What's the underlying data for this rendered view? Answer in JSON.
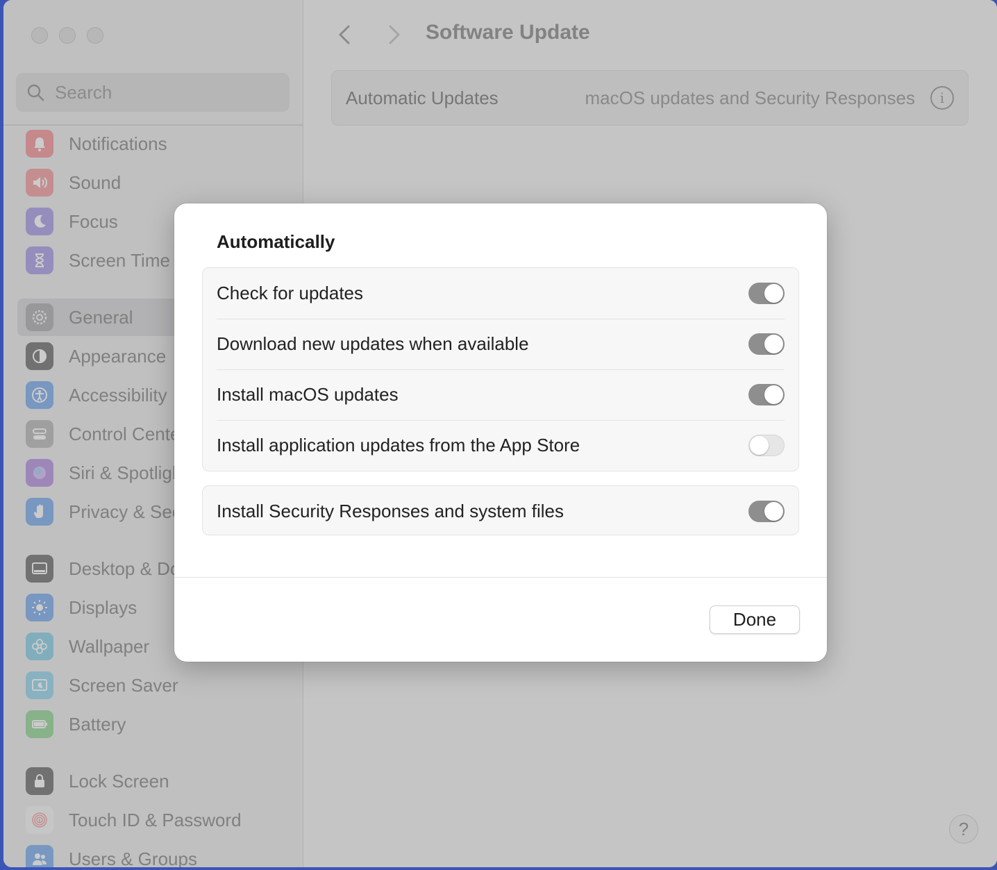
{
  "sidebar": {
    "search_placeholder": "Search",
    "items": [
      {
        "label": "Notifications",
        "icon": "bell-icon",
        "color": "#f26d72"
      },
      {
        "label": "Sound",
        "icon": "speaker-icon",
        "color": "#f07a7e"
      },
      {
        "label": "Focus",
        "icon": "moon-icon",
        "color": "#8a7be0"
      },
      {
        "label": "Screen Time",
        "icon": "hourglass-icon",
        "color": "#8a7be0"
      },
      {
        "label": "General",
        "icon": "gear-icon",
        "color": "#a0a0a0"
      },
      {
        "label": "Appearance",
        "icon": "appearance-icon",
        "color": "#3c3c3c"
      },
      {
        "label": "Accessibility",
        "icon": "accessibility-icon",
        "color": "#4a8ee8"
      },
      {
        "label": "Control Cente",
        "icon": "control-center-icon",
        "color": "#a0a0a0"
      },
      {
        "label": "Siri & Spotligh",
        "icon": "siri-icon",
        "color": "#9a6cd6"
      },
      {
        "label": "Privacy & Sec",
        "icon": "hand-icon",
        "color": "#4a8ee8"
      },
      {
        "label": "Desktop & Do",
        "icon": "desktop-icon",
        "color": "#3c3c3c"
      },
      {
        "label": "Displays",
        "icon": "sun-icon",
        "color": "#4a8ee8"
      },
      {
        "label": "Wallpaper",
        "icon": "flower-icon",
        "color": "#5ec0e0"
      },
      {
        "label": "Screen Saver",
        "icon": "screen-saver-icon",
        "color": "#6ec8e8"
      },
      {
        "label": "Battery",
        "icon": "battery-icon",
        "color": "#6dca6d"
      },
      {
        "label": "Lock Screen",
        "icon": "lock-icon",
        "color": "#3c3c3c"
      },
      {
        "label": "Touch ID & Password",
        "icon": "fingerprint-icon",
        "color": "#f5f5f5"
      },
      {
        "label": "Users & Groups",
        "icon": "users-icon",
        "color": "#4a8ee8"
      }
    ]
  },
  "main": {
    "title": "Software Update",
    "automatic_updates_label": "Automatic Updates",
    "automatic_updates_value": "macOS updates and Security Responses",
    "help_label": "?"
  },
  "sheet": {
    "title": "Automatically",
    "group1": [
      {
        "label": "Check for updates",
        "on": true
      },
      {
        "label": "Download new updates when available",
        "on": true
      },
      {
        "label": "Install macOS updates",
        "on": true
      },
      {
        "label": "Install application updates from the App Store",
        "on": false
      }
    ],
    "group2": [
      {
        "label": "Install Security Responses and system files",
        "on": true
      }
    ],
    "done_label": "Done"
  }
}
